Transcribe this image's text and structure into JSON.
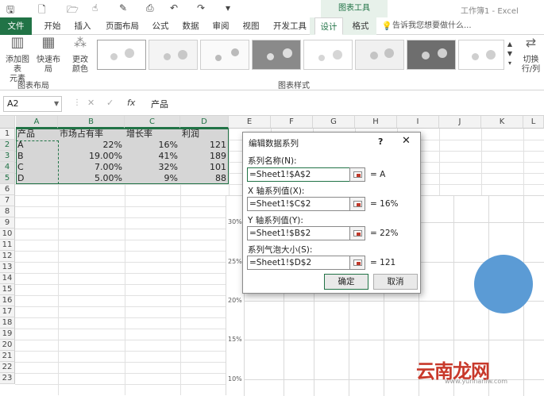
{
  "window": {
    "title": "工作簿1 - Excel",
    "chart_tools_label": "图表工具"
  },
  "tabs": [
    "文件",
    "开始",
    "插入",
    "页面布局",
    "公式",
    "数据",
    "审阅",
    "视图",
    "开发工具",
    "设计",
    "格式"
  ],
  "tell_me": "告诉我您想要做什么...",
  "ribbon": {
    "add_element": "添加图表\n元素",
    "quick_layout": "快速布局",
    "change_color": "更改\n颜色",
    "switch_rowcol": "切换行/列",
    "group_layout": "图表布局",
    "group_styles": "图表样式"
  },
  "formula_bar": {
    "name_box": "A2",
    "fx": "fx",
    "formula": "产品"
  },
  "columns": [
    "A",
    "B",
    "C",
    "D",
    "E",
    "F",
    "G",
    "H",
    "I",
    "J",
    "K",
    "L"
  ],
  "rows": [
    "1",
    "2",
    "3",
    "4",
    "5",
    "6",
    "7",
    "8",
    "9",
    "10",
    "11",
    "12",
    "13",
    "14",
    "15",
    "16",
    "17",
    "18",
    "19",
    "20",
    "21",
    "22",
    "23"
  ],
  "table": {
    "headers": [
      "产品",
      "市场占有率",
      "增长率",
      "利润"
    ],
    "rows": [
      [
        "A",
        "22%",
        "16%",
        "121"
      ],
      [
        "B",
        "19.00%",
        "41%",
        "189"
      ],
      [
        "C",
        "7.00%",
        "32%",
        "101"
      ],
      [
        "D",
        "5.00%",
        "9%",
        "88"
      ]
    ]
  },
  "chart": {
    "yticks": [
      "30%",
      "25%",
      "20%",
      "15%",
      "10%"
    ],
    "bubble_color": "#5b9bd5"
  },
  "dialog": {
    "title": "编辑数据系列",
    "help": "?",
    "close": "✕",
    "fields": [
      {
        "label": "系列名称(N):",
        "value": "=Sheet1!$A$2",
        "result": "= A"
      },
      {
        "label": "X 轴系列值(X):",
        "value": "=Sheet1!$C$2",
        "result": "= 16%"
      },
      {
        "label": "Y 轴系列值(Y):",
        "value": "=Sheet1!$B$2",
        "result": "= 22%"
      },
      {
        "label": "系列气泡大小(S):",
        "value": "=Sheet1!$D$2",
        "result": "= 121"
      }
    ],
    "ok": "确定",
    "cancel": "取消"
  },
  "watermark": {
    "text": "云南龙网",
    "sub": "www.yunnanlw.com"
  }
}
